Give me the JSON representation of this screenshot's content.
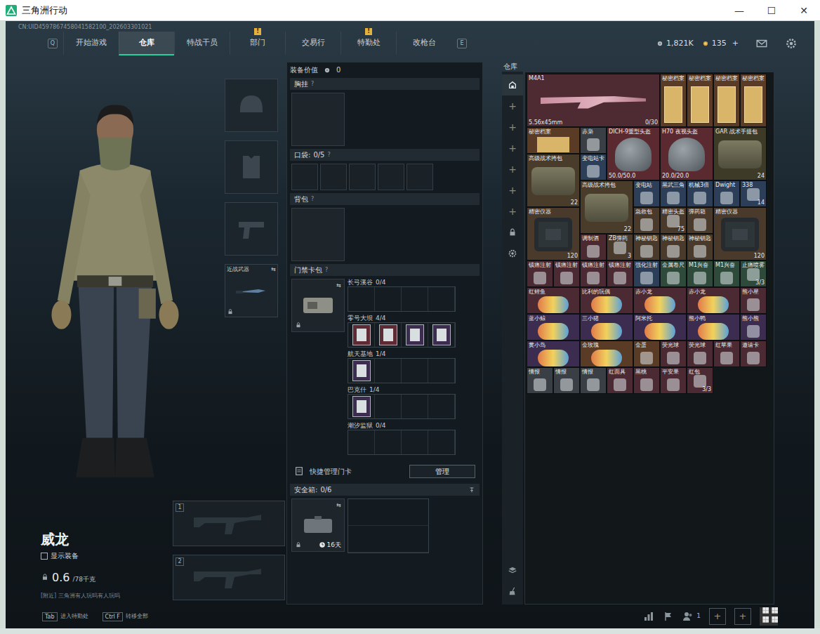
{
  "window": {
    "title": "三角洲行动",
    "controls": [
      "—",
      "☐",
      "✕"
    ]
  },
  "header": {
    "uid": "CN:UID4597867458041582100_202603301021",
    "keys": [
      "Q",
      "E"
    ],
    "tabs": [
      {
        "label": "开始游戏",
        "selected": false
      },
      {
        "label": "仓库",
        "selected": true
      },
      {
        "label": "特战干员",
        "selected": false
      },
      {
        "label": "部门",
        "selected": false,
        "badge": "!"
      },
      {
        "label": "交易行",
        "selected": false
      },
      {
        "label": "特勤处",
        "selected": false,
        "badge": "!"
      },
      {
        "label": "改枪台",
        "selected": false
      }
    ],
    "coins": "1,821K",
    "tickets": "135",
    "add": "+"
  },
  "character": {
    "name": "威龙",
    "show_gear": {
      "label": "显示装备",
      "checked": false
    },
    "weight": "0.6",
    "weight_max": "/78千克",
    "chat": "[附近] 三角洲有人玩吗有人玩吗",
    "gear_slots": [
      {
        "kind": "helmet"
      },
      {
        "kind": "armor"
      },
      {
        "kind": "pistol"
      },
      {
        "kind": "melee",
        "label": "近战武器",
        "swap": "⇆",
        "locked": true
      }
    ],
    "weapon_slots": [
      {
        "number": "1"
      },
      {
        "number": "2"
      }
    ]
  },
  "loadout": {
    "value_label": "装备价值",
    "value": "0",
    "chest": {
      "label": "胸挂",
      "help": "?"
    },
    "pockets": {
      "label": "口袋:",
      "count": "0/5",
      "help": "?",
      "slots": [
        {
          "filled": false
        },
        {
          "filled": false
        },
        {
          "filled": false
        },
        {
          "filled": false
        },
        {
          "filled": false
        }
      ]
    },
    "backpack": {
      "label": "背包",
      "help": "?"
    },
    "card_pack": {
      "label": "门禁卡包",
      "help": "?",
      "swap": "⇆",
      "locked": true,
      "maps": [
        {
          "name": "长弓溪谷",
          "count": "0/4",
          "cards": [
            {
              "filled": false
            },
            {
              "filled": false
            },
            {
              "filled": false
            },
            {
              "filled": false
            }
          ]
        },
        {
          "name": "零号大坝",
          "count": "4/4",
          "cards": [
            {
              "filled": true,
              "color": "#5e2a33"
            },
            {
              "filled": true,
              "color": "#5e2a33"
            },
            {
              "filled": true,
              "color": "#3b2c50"
            },
            {
              "filled": true,
              "color": "#3b2c50"
            }
          ]
        },
        {
          "name": "航天基地",
          "count": "1/4",
          "cards": [
            {
              "filled": true,
              "color": "#3b2c50"
            },
            {
              "filled": false
            },
            {
              "filled": false
            },
            {
              "filled": false
            }
          ]
        },
        {
          "name": "巴克什",
          "count": "1/4",
          "cards": [
            {
              "filled": true,
              "color": "#3b2c50"
            },
            {
              "filled": false
            },
            {
              "filled": false
            },
            {
              "filled": false
            }
          ]
        },
        {
          "name": "潮汐监狱",
          "count": "0/4",
          "cards": [
            {
              "filled": false
            },
            {
              "filled": false
            },
            {
              "filled": false
            },
            {
              "filled": false
            }
          ]
        }
      ]
    },
    "quick_manage": {
      "label": "快捷管理门卡",
      "button": "管理"
    },
    "safe": {
      "label": "安全箱:",
      "count": "0/6",
      "days": "16天",
      "swap": "⇆",
      "locked": true
    }
  },
  "warehouse": {
    "title": "仓库",
    "side": [
      {
        "kind": "home",
        "selected": true
      },
      {
        "kind": "add",
        "label": "+",
        "selected": false
      },
      {
        "kind": "add",
        "label": "+",
        "selected": false
      },
      {
        "kind": "add",
        "label": "+",
        "selected": false
      },
      {
        "kind": "add",
        "label": "+",
        "selected": false
      },
      {
        "kind": "add",
        "label": "+",
        "selected": false
      },
      {
        "kind": "add",
        "label": "+",
        "selected": false
      },
      {
        "kind": "lock",
        "selected": false
      },
      {
        "kind": "gear",
        "selected": false
      }
    ],
    "side_bottom": [
      {
        "kind": "layers",
        "selected": false
      },
      {
        "kind": "broom",
        "selected": false
      }
    ],
    "items": [
      {
        "kind": "gun",
        "label": "M4A1",
        "sub": "5.56x45mm",
        "count": "0/30",
        "color": "#4e2a33"
      },
      {
        "kind": "doc",
        "label": "秘密档案",
        "color": "#5a3b25"
      },
      {
        "kind": "doc",
        "label": "秘密档案",
        "color": "#5a3b25"
      },
      {
        "kind": "doc",
        "label": "秘密档案",
        "color": "#5a3b25"
      },
      {
        "kind": "doc",
        "label": "秘密档案",
        "color": "#5a3b25"
      },
      {
        "kind": "docw",
        "label": "秘密档案",
        "color": "#5a3b25"
      },
      {
        "kind": "small",
        "label": "赤枭",
        "color": "#3a3f45"
      },
      {
        "kind": "helmet",
        "label": "DICH-9重型头盔",
        "sub": "50.0/50.0",
        "color": "#5b2a30"
      },
      {
        "kind": "helmet",
        "label": "H70 夜视头盔",
        "sub": "20.0/20.0",
        "color": "#5b2a30"
      },
      {
        "kind": "bag",
        "label": "GAR 战术手提包",
        "count": "24",
        "color": "#3d3a28"
      },
      {
        "kind": "bag",
        "label": "高级战术挎包",
        "count": "22",
        "color": "#4a3c2a"
      },
      {
        "kind": "small",
        "label": "变电站卡",
        "color": "#2c3e58"
      },
      {
        "kind": "bag",
        "label": "高级战术挎包",
        "count": "22",
        "color": "#4a3c2a"
      },
      {
        "kind": "small",
        "label": "变电站",
        "color": "#2c3e58"
      },
      {
        "kind": "small",
        "label": "黑武三角",
        "color": "#2c3e58"
      },
      {
        "kind": "small",
        "label": "机械3倍",
        "color": "#2c3e58"
      },
      {
        "kind": "small",
        "label": "Dwight",
        "color": "#2c3e58"
      },
      {
        "kind": "small",
        "label": "338",
        "count": "14",
        "color": "#2c3e58"
      },
      {
        "kind": "case",
        "label": "精密仪器",
        "count": "120",
        "color": "#4a3a2c"
      },
      {
        "kind": "small",
        "label": "急救包",
        "color": "#4a3a2c"
      },
      {
        "kind": "small",
        "label": "精密头盔",
        "count": "75",
        "color": "#4a3a2c"
      },
      {
        "kind": "small",
        "label": "弹药箱",
        "color": "#4a3a2c"
      },
      {
        "kind": "case",
        "label": "精密仪器",
        "count": "120",
        "color": "#4a3a2c"
      },
      {
        "kind": "small",
        "label": "调制酒",
        "color": "#4a2a30"
      },
      {
        "kind": "small",
        "label": "ZB弹药",
        "count": "3",
        "color": "#4a3a2c"
      },
      {
        "kind": "small",
        "label": "神秘钥匙",
        "color": "#4a3a2c"
      },
      {
        "kind": "small",
        "label": "神秘钥匙",
        "color": "#4a3a2c"
      },
      {
        "kind": "small",
        "label": "神秘钥匙",
        "color": "#4a3a2c"
      },
      {
        "kind": "small",
        "label": "镇痛注射",
        "color": "#4b2a33"
      },
      {
        "kind": "small",
        "label": "镇痛注射",
        "color": "#4b2a33"
      },
      {
        "kind": "small",
        "label": "镇痛注射",
        "color": "#4b2a33"
      },
      {
        "kind": "small",
        "label": "镇痛注射",
        "color": "#4b2a33"
      },
      {
        "kind": "small",
        "label": "强化注射",
        "color": "#2c3e58"
      },
      {
        "kind": "small",
        "label": "金属卷尺",
        "color": "#2e4a3a"
      },
      {
        "kind": "small",
        "label": "M1兴奋",
        "color": "#2e4a3a"
      },
      {
        "kind": "small",
        "label": "M1兴奋",
        "color": "#2e4a3a"
      },
      {
        "kind": "small",
        "label": "止痛喷雾",
        "count": "3/3",
        "color": "#2e4a3a"
      },
      {
        "kind": "wide",
        "label": "红鲤鱼",
        "color": "#4b2a33"
      },
      {
        "kind": "wide",
        "label": "比利的玩偶",
        "color": "#4b2a33"
      },
      {
        "kind": "wide",
        "label": "赤小龙",
        "color": "#4b2a33"
      },
      {
        "kind": "wide",
        "label": "赤小龙",
        "color": "#4b2a33"
      },
      {
        "kind": "small",
        "label": "熊小星",
        "color": "#4b2a33"
      },
      {
        "kind": "wide",
        "label": "蓝小鲸",
        "color": "#3b2c50"
      },
      {
        "kind": "wide",
        "label": "三小猪",
        "color": "#3b2c50"
      },
      {
        "kind": "wide",
        "label": "阿米托",
        "color": "#3b2c50"
      },
      {
        "kind": "wide",
        "label": "熊小鸭",
        "color": "#3b2c50"
      },
      {
        "kind": "small",
        "label": "熊小熊",
        "color": "#3b2c50"
      },
      {
        "kind": "wide",
        "label": "黄小鸟",
        "color": "#3b2c50"
      },
      {
        "kind": "wide",
        "label": "金玫瑰",
        "color": "#5a3b25"
      },
      {
        "kind": "small",
        "label": "金蛋",
        "color": "#5a3b25"
      },
      {
        "kind": "small",
        "label": "荧光球",
        "color": "#4b2a33"
      },
      {
        "kind": "small",
        "label": "荧光球",
        "color": "#4b2a33"
      },
      {
        "kind": "small",
        "label": "红苹果",
        "color": "#4b2a33"
      },
      {
        "kind": "small",
        "label": "邀请卡",
        "color": "#4b2a33"
      },
      {
        "kind": "small",
        "label": "情报",
        "color": "#3a3f45"
      },
      {
        "kind": "small",
        "label": "情报",
        "color": "#3a3f45"
      },
      {
        "kind": "small",
        "label": "情报",
        "color": "#3a3f45"
      },
      {
        "kind": "small",
        "label": "红面具",
        "color": "#4b2a33"
      },
      {
        "kind": "small",
        "label": "黑桃",
        "color": "#4b2a33"
      },
      {
        "kind": "small",
        "label": "平安果",
        "color": "#4b2a33"
      },
      {
        "kind": "small",
        "label": "红包",
        "count": "3/3",
        "color": "#4b2a33"
      }
    ]
  },
  "bottom": {
    "hints": [
      {
        "key": "Tab",
        "label": "进入特勤处"
      },
      {
        "key": "Ctrl F",
        "label": "转移全部"
      }
    ],
    "friends": "1",
    "invite_slots": [
      "+",
      "+"
    ]
  }
}
